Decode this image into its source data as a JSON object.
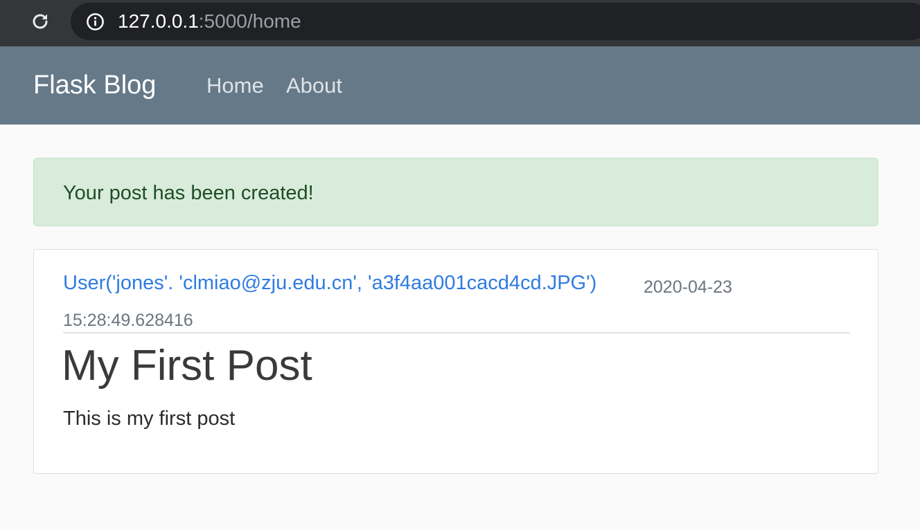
{
  "browser": {
    "url_host": "127.0.0.1",
    "url_rest": ":5000/home"
  },
  "navbar": {
    "brand": "Flask Blog",
    "links": [
      {
        "label": "Home"
      },
      {
        "label": "About"
      }
    ]
  },
  "flash": {
    "message": "Your post has been created!",
    "category": "success"
  },
  "posts": [
    {
      "author": "User('jones'. 'clmiao@zju.edu.cn', 'a3f4aa001cacd4cd.JPG')",
      "date_posted": "2020-04-23 15:28:49.628416",
      "title": "My First Post",
      "content": "This is my first post"
    }
  ],
  "colors": {
    "navbar_bg": "#667988",
    "alert_bg": "#d9ecdb",
    "alert_text": "#1e4d26",
    "link": "#2f7be0",
    "muted": "#6c757d"
  }
}
